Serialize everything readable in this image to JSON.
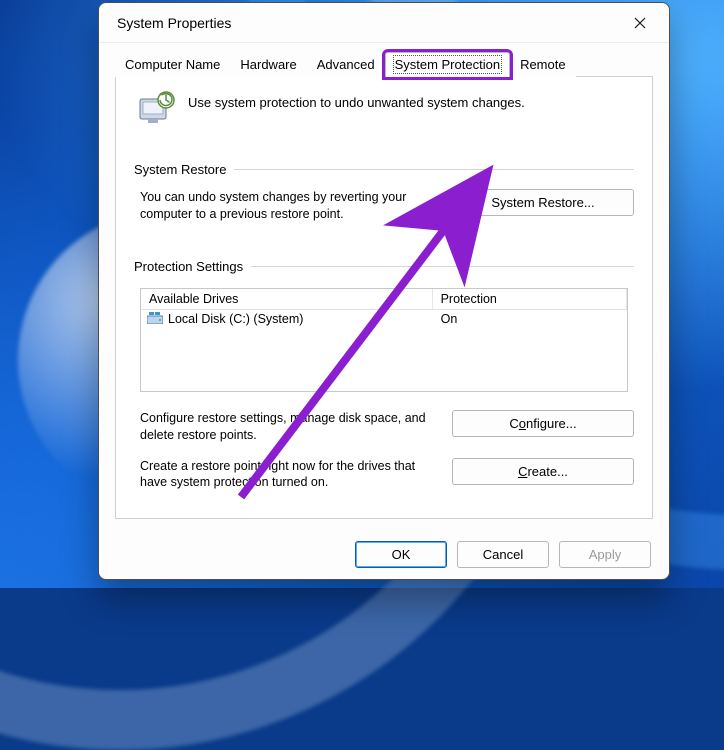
{
  "window": {
    "title": "System Properties"
  },
  "tabs": {
    "items": [
      {
        "label": "Computer Name"
      },
      {
        "label": "Hardware"
      },
      {
        "label": "Advanced"
      },
      {
        "label": "System Protection"
      },
      {
        "label": "Remote"
      }
    ],
    "active_index": 3
  },
  "intro_text": "Use system protection to undo unwanted system changes.",
  "restore": {
    "group_label": "System Restore",
    "desc": "You can undo system changes by reverting your computer to a previous restore point.",
    "button": "System Restore..."
  },
  "protection": {
    "group_label": "Protection Settings",
    "columns": {
      "a": "Available Drives",
      "b": "Protection"
    },
    "rows": [
      {
        "drive": "Local Disk (C:) (System)",
        "status": "On"
      }
    ],
    "configure_desc": "Configure restore settings, manage disk space, and delete restore points.",
    "configure_btn": "Configure...",
    "configure_mn": "o",
    "create_desc": "Create a restore point right now for the drives that have system protection turned on.",
    "create_btn": "Create...",
    "create_mn": "C"
  },
  "footer": {
    "ok": "OK",
    "cancel": "Cancel",
    "apply": "Apply"
  },
  "annotation": {
    "highlight_color": "#8b1fcf"
  }
}
